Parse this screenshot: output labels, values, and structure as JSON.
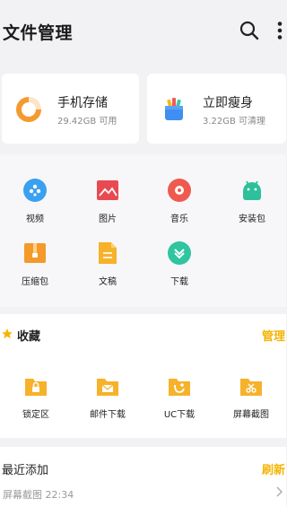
{
  "header": {
    "title": "文件管理",
    "search_icon": "search-icon",
    "more_icon": "more-vertical-icon"
  },
  "storage_cards": [
    {
      "title": "手机存储",
      "subtitle": "29.42GB 可用",
      "icon": "storage-ring-icon"
    },
    {
      "title": "立即瘦身",
      "subtitle": "3.22GB 可清理",
      "icon": "cleanup-icon"
    }
  ],
  "categories": [
    {
      "label": "视频",
      "icon": "video-icon"
    },
    {
      "label": "图片",
      "icon": "image-icon"
    },
    {
      "label": "音乐",
      "icon": "music-icon"
    },
    {
      "label": "安装包",
      "icon": "android-package-icon"
    },
    {
      "label": "压缩包",
      "icon": "archive-icon"
    },
    {
      "label": "文稿",
      "icon": "document-icon"
    },
    {
      "label": "下载",
      "icon": "download-icon"
    }
  ],
  "favorites": {
    "title": "收藏",
    "action": "管理",
    "items": [
      {
        "label": "锁定区",
        "icon": "lock-folder-icon"
      },
      {
        "label": "邮件下载",
        "icon": "mail-folder-icon"
      },
      {
        "label": "UC下载",
        "icon": "uc-folder-icon"
      },
      {
        "label": "屏幕截图",
        "icon": "screenshot-folder-icon"
      }
    ]
  },
  "recent": {
    "title": "最近添加",
    "action": "刷新",
    "item": "屏幕截图  22:34"
  },
  "colors": {
    "accent": "#f5b400",
    "background": "#f2f2f5"
  }
}
